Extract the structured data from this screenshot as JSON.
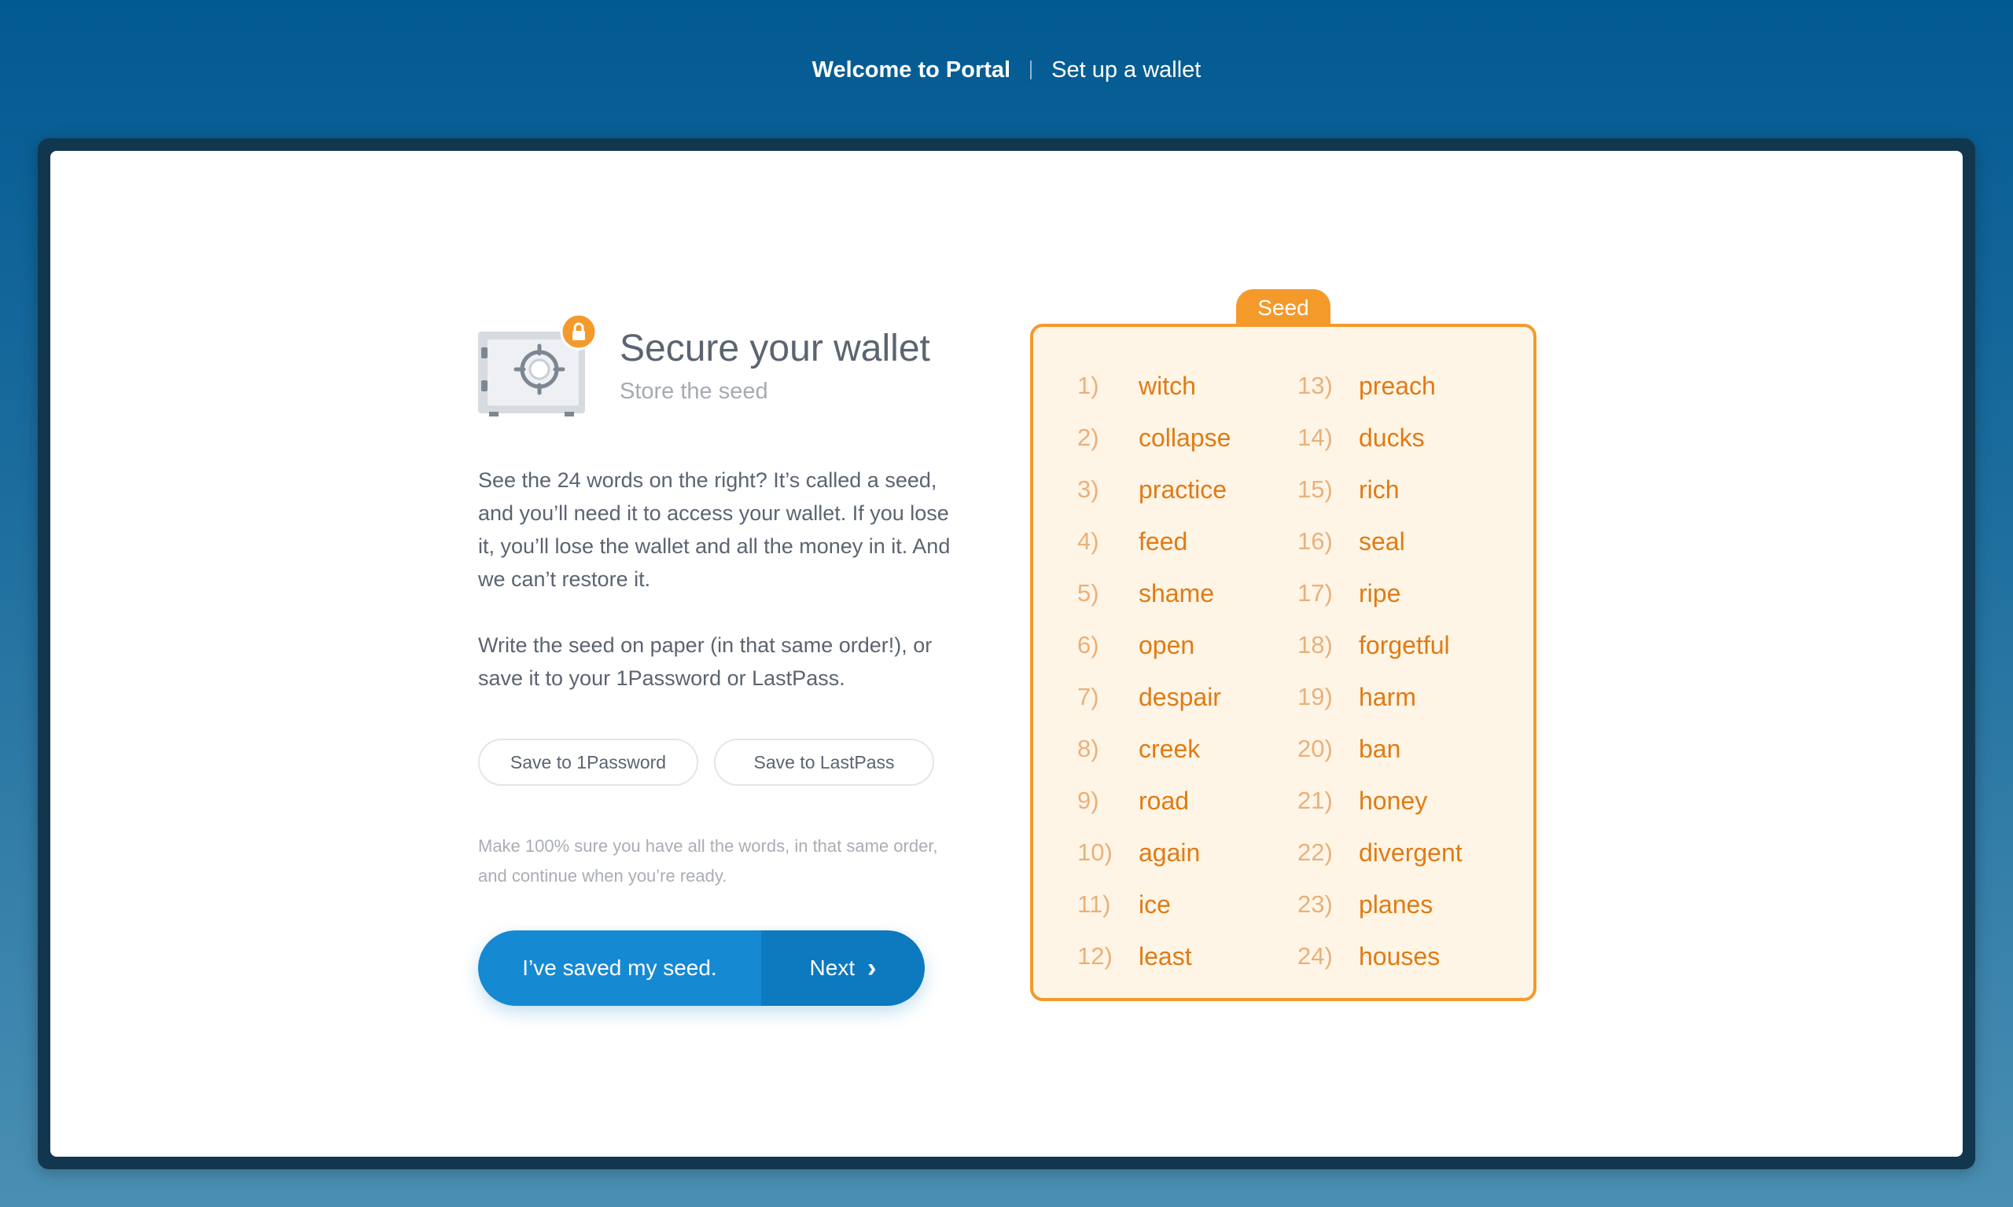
{
  "header": {
    "title": "Welcome to Portal",
    "step": "Set up a wallet"
  },
  "main": {
    "heading": "Secure your wallet",
    "subheading": "Store the seed",
    "paragraph1": "See the 24 words on the right? It’s called a seed, and you’ll need it to access your wallet. If you lose it, you’ll lose the wallet and all the money in it. And we can’t restore it.",
    "paragraph2": "Write the seed on paper (in that same order!), or save it to your 1Password or LastPass.",
    "save_1password": "Save to 1Password",
    "save_lastpass": "Save to LastPass",
    "note": "Make 100% sure you have all the words, in that same order, and continue when you’re ready.",
    "confirm_label": "I’ve saved my seed.",
    "next_label": "Next"
  },
  "seed": {
    "tab_label": "Seed",
    "words": [
      {
        "num": "1)",
        "word": "witch"
      },
      {
        "num": "2)",
        "word": "collapse"
      },
      {
        "num": "3)",
        "word": "practice"
      },
      {
        "num": "4)",
        "word": "feed"
      },
      {
        "num": "5)",
        "word": "shame"
      },
      {
        "num": "6)",
        "word": "open"
      },
      {
        "num": "7)",
        "word": "despair"
      },
      {
        "num": "8)",
        "word": "creek"
      },
      {
        "num": "9)",
        "word": "road"
      },
      {
        "num": "10)",
        "word": "again"
      },
      {
        "num": "11)",
        "word": "ice"
      },
      {
        "num": "12)",
        "word": "least"
      },
      {
        "num": "13)",
        "word": "preach"
      },
      {
        "num": "14)",
        "word": "ducks"
      },
      {
        "num": "15)",
        "word": "rich"
      },
      {
        "num": "16)",
        "word": "seal"
      },
      {
        "num": "17)",
        "word": "ripe"
      },
      {
        "num": "18)",
        "word": "forgetful"
      },
      {
        "num": "19)",
        "word": "harm"
      },
      {
        "num": "20)",
        "word": "ban"
      },
      {
        "num": "21)",
        "word": "honey"
      },
      {
        "num": "22)",
        "word": "divergent"
      },
      {
        "num": "23)",
        "word": "planes"
      },
      {
        "num": "24)",
        "word": "houses"
      }
    ]
  },
  "colors": {
    "accent": "#f39a2b",
    "primary": "#1689d3",
    "seed_text": "#e07b15"
  },
  "icons": {
    "safe": "safe-icon",
    "lock": "lock-icon",
    "next": "chevron-right-icon"
  }
}
